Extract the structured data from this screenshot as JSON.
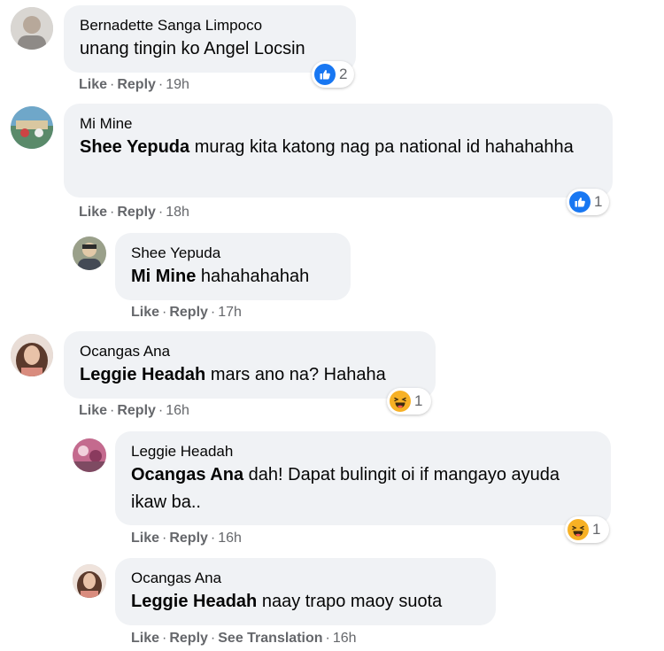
{
  "labels": {
    "like": "Like",
    "reply": "Reply",
    "see_translation": "See Translation",
    "dot": "·"
  },
  "comments": [
    {
      "author": "Bernadette Sanga Limpoco",
      "mention": "",
      "text": "unang tingin ko Angel Locsin",
      "time": "19h",
      "reaction": {
        "type": "like-icon",
        "count": "2"
      }
    },
    {
      "author": "Mi Mine",
      "mention": "Shee Yepuda",
      "text": " murag kita katong nag pa national id hahahahha",
      "time": "18h",
      "reaction": {
        "type": "like-icon",
        "count": "1"
      }
    },
    {
      "author": "Shee Yepuda",
      "mention": "Mi Mine",
      "text": " hahahahahah",
      "time": "17h"
    },
    {
      "author": "Ocangas Ana",
      "mention": "Leggie Headah",
      "text": " mars ano na? Hahaha",
      "time": "16h",
      "reaction": {
        "type": "haha-icon",
        "count": "1"
      }
    },
    {
      "author": "Leggie Headah",
      "mention": "Ocangas Ana",
      "text": " dah! Dapat bulingit oi if mangayo ayuda ikaw ba..",
      "time": "16h",
      "reaction": {
        "type": "haha-icon",
        "count": "1"
      }
    },
    {
      "author": "Ocangas Ana",
      "mention": "Leggie Headah",
      "text": " naay trapo maoy suota",
      "time": "16h"
    }
  ],
  "colors": {
    "bubble": "#f0f2f5",
    "meta": "#65676b",
    "like_blue": "#1877f2",
    "haha_yellow": "#f7b125"
  }
}
